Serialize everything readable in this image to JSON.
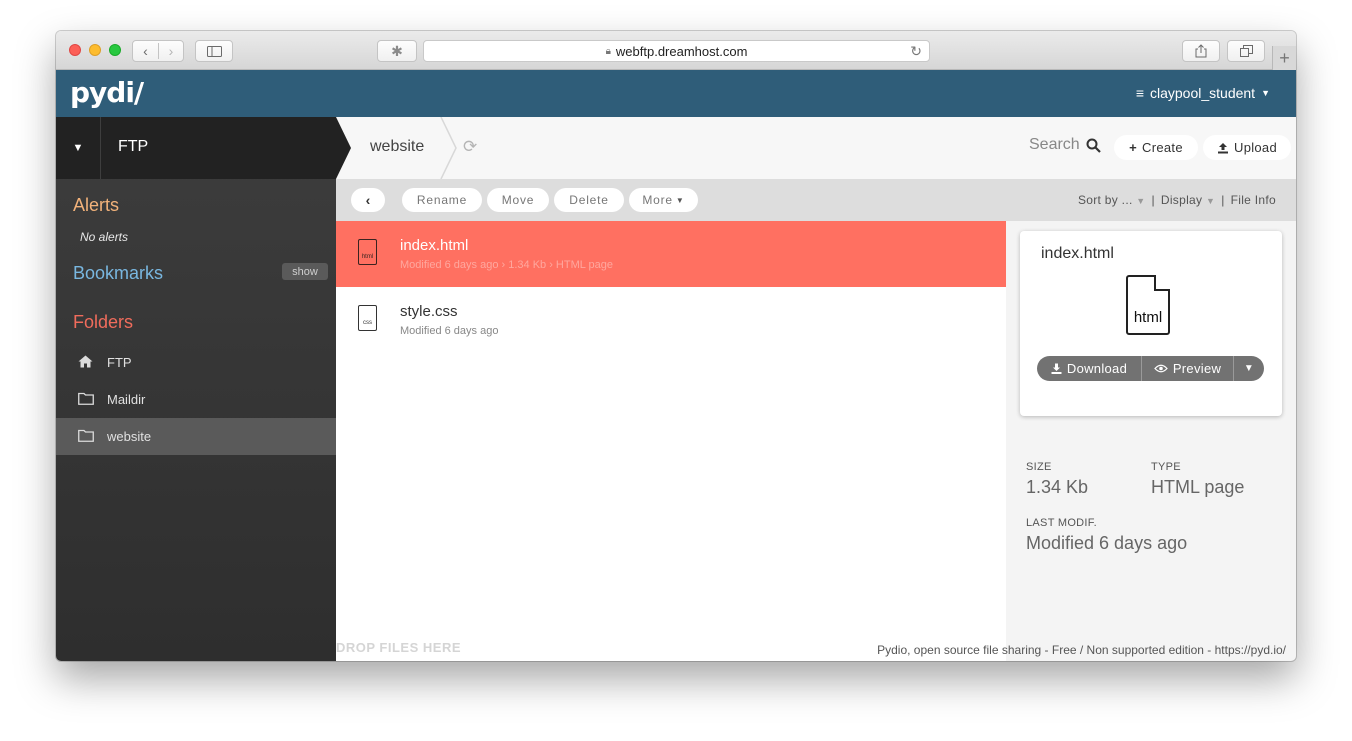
{
  "browser": {
    "url": "webftp.dreamhost.com",
    "icons": {
      "back": "chevron-left-icon",
      "forward": "chevron-right-icon",
      "lock": "lock-icon",
      "reload": "reload-icon",
      "new_tab": "plus-icon"
    }
  },
  "header": {
    "logo": "pydi/",
    "user": "claypool_student"
  },
  "sidebar": {
    "workspace": "FTP",
    "alerts_title": "Alerts",
    "no_alerts": "No alerts",
    "bookmarks_title": "Bookmarks",
    "show_label": "show",
    "folders_title": "Folders",
    "folders": [
      {
        "label": "FTP",
        "icon": "home-icon",
        "active": false
      },
      {
        "label": "Maildir",
        "icon": "folder-icon",
        "active": false
      },
      {
        "label": "website",
        "icon": "folder-icon",
        "active": true
      }
    ]
  },
  "breadcrumb": {
    "current": "website"
  },
  "search": {
    "label": "Search"
  },
  "buttons": {
    "create": "Create",
    "upload": "Upload"
  },
  "actions": {
    "rename": "Rename",
    "move": "Move",
    "delete": "Delete",
    "more": "More"
  },
  "view": {
    "sort_by": "Sort by ...",
    "display": "Display",
    "file_info": "File Info"
  },
  "files": [
    {
      "name": "index.html",
      "icon_label": "html",
      "meta": "Modified 6 days ago  ›  1.34 Kb  ›  HTML page",
      "selected": true
    },
    {
      "name": "style.css",
      "icon_label": "css",
      "meta": "Modified 6 days ago",
      "selected": false
    }
  ],
  "drop_hint": "DROP FILES HERE",
  "footer": "Pydio, open source file sharing - Free / Non supported edition - https://pyd.io/",
  "info": {
    "filename": "index.html",
    "icon_label": "html",
    "download": "Download",
    "preview": "Preview",
    "size_label": "SIZE",
    "size_value": "1.34 Kb",
    "type_label": "TYPE",
    "type_value": "HTML page",
    "modif_label": "LAST MODIF.",
    "modif_value": "Modified 6 days ago"
  },
  "colors": {
    "header_bg": "#2f5d79",
    "selected_row": "#ff7061",
    "alerts": "#f2b27a",
    "bookmarks": "#79b7e0",
    "folders": "#f06c5c"
  }
}
